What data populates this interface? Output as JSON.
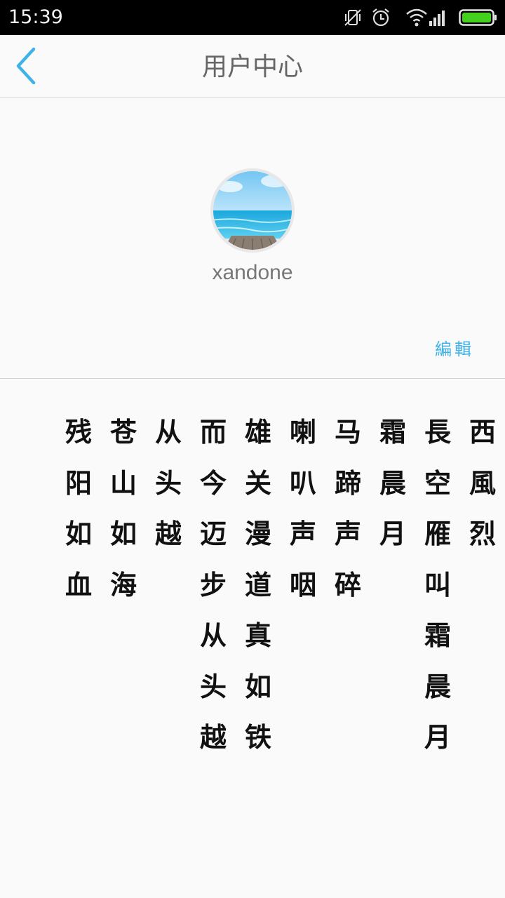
{
  "status_bar": {
    "time": "15:39",
    "icons": [
      "vibrate-off-icon",
      "alarm-icon",
      "wifi-icon",
      "signal-icon",
      "battery-icon"
    ],
    "battery_color": "#44d11d"
  },
  "header": {
    "title": "用户中心",
    "back_icon": "chevron-left-icon",
    "back_color": "#3fb3e8"
  },
  "profile": {
    "username": "xandone",
    "edit_label": "編輯"
  },
  "poem": {
    "columns": [
      "西風烈",
      "長空雁叫霜晨月",
      "霜晨月",
      "马蹄声碎",
      "喇叭声咽",
      "雄关漫道真如铁",
      "而今迈步从头越",
      "从头越",
      "苍山如海",
      "残阳如血"
    ]
  }
}
